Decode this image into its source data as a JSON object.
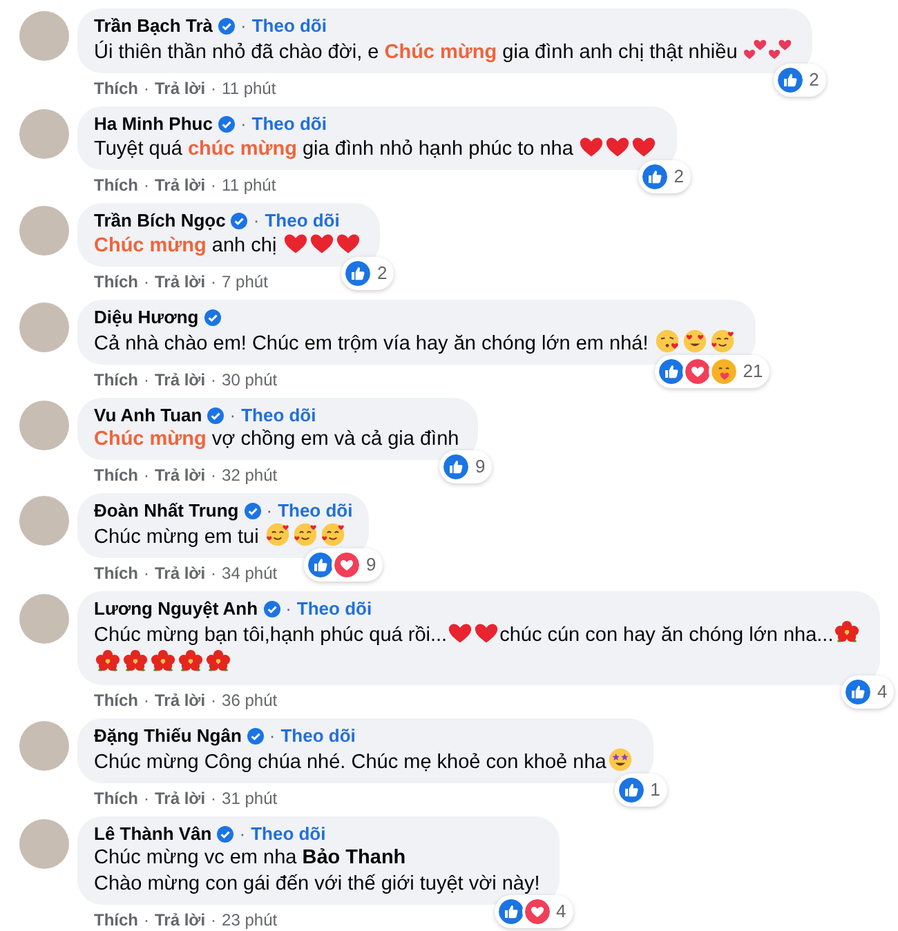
{
  "separator": "·",
  "comments": [
    {
      "name": "Trần Bạch Trà",
      "verified": true,
      "follow": "Theo dõi",
      "lines": [
        [
          {
            "kind": "plain",
            "text": "Úi thiên thần nhỏ đã chào đời, e "
          },
          {
            "kind": "highlight",
            "text": "Chúc mừng"
          },
          {
            "kind": "plain",
            "text": " gia đình anh chị thật nhiều "
          },
          {
            "kind": "twohearts"
          },
          {
            "kind": "twohearts"
          }
        ]
      ],
      "reactions": [
        {
          "kind": "like"
        }
      ],
      "reaction_count": "2",
      "like": "Thích",
      "reply": "Trả lời",
      "time": "11 phút"
    },
    {
      "name": "Ha Minh Phuc",
      "verified": true,
      "follow": "Theo dõi",
      "lines": [
        [
          {
            "kind": "plain",
            "text": "Tuyệt quá "
          },
          {
            "kind": "highlight",
            "text": "chúc mừng"
          },
          {
            "kind": "plain",
            "text": " gia đình nhỏ hạnh phúc to nha "
          },
          {
            "kind": "heart"
          },
          {
            "kind": "heart"
          },
          {
            "kind": "heart"
          }
        ]
      ],
      "reactions": [
        {
          "kind": "like"
        }
      ],
      "reaction_count": "2",
      "like": "Thích",
      "reply": "Trả lời",
      "time": "11 phút"
    },
    {
      "name": "Trần Bích Ngọc",
      "verified": true,
      "follow": "Theo dõi",
      "lines": [
        [
          {
            "kind": "highlight",
            "text": "Chúc mừng"
          },
          {
            "kind": "plain",
            "text": " anh chị "
          },
          {
            "kind": "heart"
          },
          {
            "kind": "heart"
          },
          {
            "kind": "heart"
          }
        ]
      ],
      "reactions": [
        {
          "kind": "like"
        }
      ],
      "reaction_count": "2",
      "like": "Thích",
      "reply": "Trả lời",
      "time": "7 phút"
    },
    {
      "name": "Diệu Hương",
      "verified": true,
      "lines": [
        [
          {
            "kind": "plain",
            "text": "Cả nhà chào em! Chúc em trộm vía hay ăn chóng lớn em nhá! "
          },
          {
            "kind": "kiss"
          },
          {
            "kind": "hearteyes"
          },
          {
            "kind": "lovingface"
          }
        ]
      ],
      "reactions": [
        {
          "kind": "like"
        },
        {
          "kind": "love"
        },
        {
          "kind": "care"
        }
      ],
      "reaction_count": "21",
      "like": "Thích",
      "reply": "Trả lời",
      "time": "30 phút"
    },
    {
      "name": "Vu Anh Tuan",
      "verified": true,
      "follow": "Theo dõi",
      "lines": [
        [
          {
            "kind": "highlight",
            "text": "Chúc mừng"
          },
          {
            "kind": "plain",
            "text": " vợ chồng em và cả gia đình"
          }
        ]
      ],
      "reactions": [
        {
          "kind": "like"
        }
      ],
      "reaction_count": "9",
      "like": "Thích",
      "reply": "Trả lời",
      "time": "32 phút"
    },
    {
      "name": "Đoàn Nhất Trung",
      "verified": true,
      "follow": "Theo dõi",
      "lines": [
        [
          {
            "kind": "plain",
            "text": "Chúc mừng em tui "
          },
          {
            "kind": "lovingface"
          },
          {
            "kind": "lovingface"
          },
          {
            "kind": "lovingface"
          }
        ]
      ],
      "reactions": [
        {
          "kind": "like"
        },
        {
          "kind": "love"
        }
      ],
      "reaction_count": "9",
      "like": "Thích",
      "reply": "Trả lời",
      "time": "34 phút"
    },
    {
      "name": "Lương Nguyệt Anh",
      "verified": true,
      "follow": "Theo dõi",
      "lines": [
        [
          {
            "kind": "plain",
            "text": "Chúc mừng bạn tôi,hạnh phúc quá rồi..."
          },
          {
            "kind": "heart"
          },
          {
            "kind": "heart"
          },
          {
            "kind": "plain",
            "text": "chúc cún con hay ăn chóng lớn nha..."
          },
          {
            "kind": "hibiscus"
          }
        ],
        [
          {
            "kind": "hibiscus"
          },
          {
            "kind": "hibiscus"
          },
          {
            "kind": "hibiscus"
          },
          {
            "kind": "hibiscus"
          },
          {
            "kind": "hibiscus"
          }
        ]
      ],
      "reactions": [
        {
          "kind": "like"
        }
      ],
      "reaction_count": "4",
      "like": "Thích",
      "reply": "Trả lời",
      "time": "36 phút"
    },
    {
      "name": "Đặng Thiếu Ngân",
      "verified": true,
      "follow": "Theo dõi",
      "lines": [
        [
          {
            "kind": "plain",
            "text": "Chúc mừng Công chúa nhé. Chúc mẹ khoẻ con khoẻ nha"
          },
          {
            "kind": "stareyes"
          }
        ]
      ],
      "reactions": [
        {
          "kind": "like"
        }
      ],
      "reaction_count": "1",
      "like": "Thích",
      "reply": "Trả lời",
      "time": "31 phút"
    },
    {
      "name": "Lê Thành Vân",
      "verified": true,
      "follow": "Theo dõi",
      "lines": [
        [
          {
            "kind": "plain",
            "text": "Chúc mừng vc em nha "
          },
          {
            "kind": "mention",
            "text": "Bảo Thanh"
          }
        ],
        [
          {
            "kind": "plain",
            "text": "Chào mừng con gái đến với thế giới tuyệt vời này!"
          }
        ]
      ],
      "reactions": [
        {
          "kind": "like"
        },
        {
          "kind": "love"
        }
      ],
      "reaction_count": "4",
      "like": "Thích",
      "reply": "Trả lời",
      "time": "23 phút"
    }
  ]
}
